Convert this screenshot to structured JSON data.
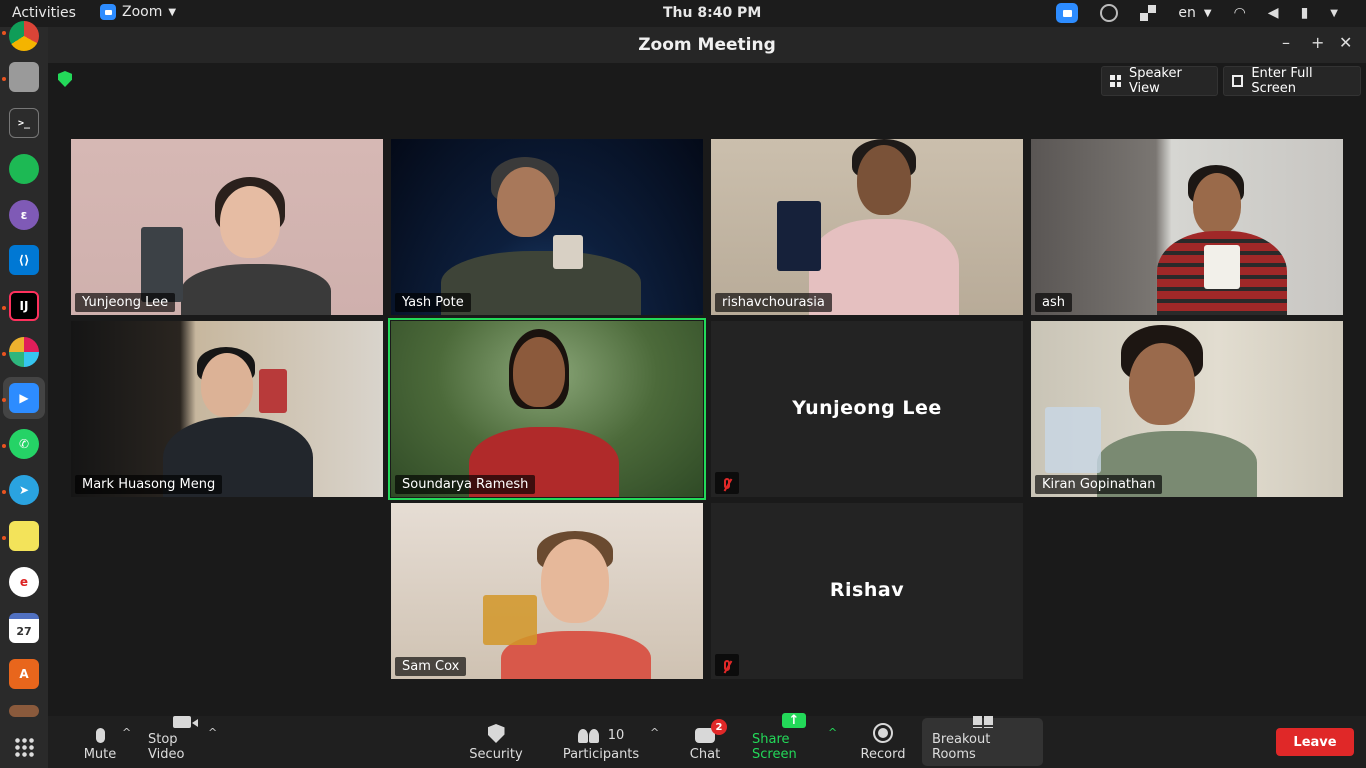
{
  "topbar": {
    "activities": "Activities",
    "app_name": "Zoom",
    "clock": "Thu  8:40 PM",
    "language": "en"
  },
  "dock": {
    "apps": [
      "chrome-icon",
      "files-icon",
      "terminal-icon",
      "spotify-icon",
      "emacs-icon",
      "vscode-icon",
      "intellij-icon",
      "slack-icon",
      "zoom-icon",
      "whatsapp-icon",
      "telegram-icon",
      "sticky-notes-icon",
      "pdf-reader-icon",
      "calendar-icon",
      "software-center-icon",
      "folder-icon"
    ],
    "calendar_day": "27"
  },
  "window": {
    "title": "Zoom Meeting",
    "speaker_view": "Speaker View",
    "full_screen": "Enter Full Screen"
  },
  "participants": [
    {
      "name": "Yunjeong Lee",
      "video": true
    },
    {
      "name": "Yash Pote",
      "video": true
    },
    {
      "name": "rishavchourasia",
      "video": true
    },
    {
      "name": "ash",
      "video": true
    },
    {
      "name": "Mark Huasong Meng",
      "video": true
    },
    {
      "name": "Soundarya Ramesh",
      "video": true,
      "active_speaker": true
    },
    {
      "name": "Yunjeong Lee",
      "video": false,
      "muted": true
    },
    {
      "name": "Kiran Gopinathan",
      "video": true
    },
    {
      "name": "Sam Cox",
      "video": true
    },
    {
      "name": "Rishav",
      "video": false,
      "muted": true
    }
  ],
  "toolbar": {
    "mute": "Mute",
    "stop_video": "Stop Video",
    "security": "Security",
    "participants": "Participants",
    "participant_count": "10",
    "chat": "Chat",
    "chat_badge": "2",
    "share_screen": "Share Screen",
    "record": "Record",
    "breakout_rooms": "Breakout Rooms",
    "leave": "Leave"
  },
  "colors": {
    "accent_green": "#23d959",
    "leave_red": "#e02828",
    "zoom_blue": "#2d8cff"
  }
}
